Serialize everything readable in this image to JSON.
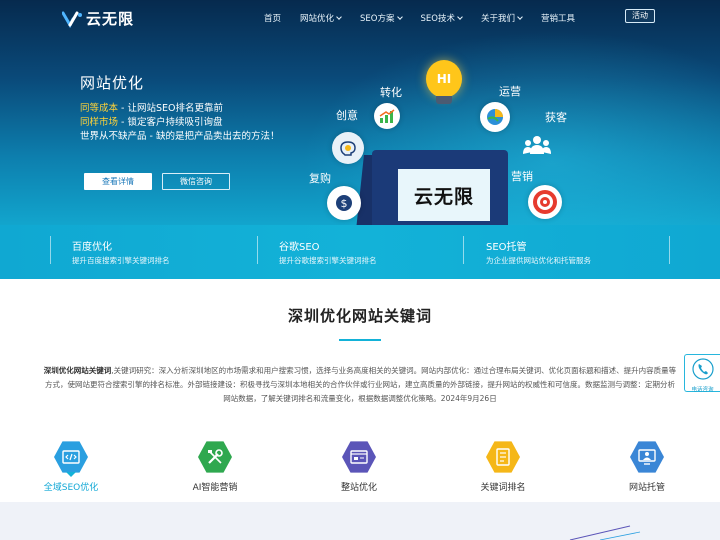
{
  "logo": {
    "text": "云无限"
  },
  "nav": {
    "items": [
      {
        "label": "首页",
        "dropdown": false
      },
      {
        "label": "网站优化",
        "dropdown": true
      },
      {
        "label": "SEO方案",
        "dropdown": true
      },
      {
        "label": "SEO技术",
        "dropdown": true
      },
      {
        "label": "关于我们",
        "dropdown": true
      },
      {
        "label": "营销工具",
        "dropdown": false
      }
    ],
    "action_label": "活动"
  },
  "hero": {
    "title": "网站优化",
    "line1_highlight": "同等成本",
    "line1_rest": " - 让网站SEO排名更靠前",
    "line2_highlight": "同样市场",
    "line2_rest": " - 锁定客户持续吸引询盘",
    "line3": "世界从不缺产品 - 缺的是把产品卖出去的方法！",
    "detail_button": "查看详情",
    "consult_button": "微信咨询",
    "illustration": {
      "words": [
        "创意",
        "转化",
        "运营",
        "获客",
        "复购",
        "营销"
      ],
      "bulb_text": "HI",
      "screen_text": "云无限"
    }
  },
  "services": [
    {
      "title": "百度优化",
      "desc": "提升百度搜索引擎关键词排名"
    },
    {
      "title": "谷歌SEO",
      "desc": "提升谷歌搜索引擎关键词排名"
    },
    {
      "title": "SEO托管",
      "desc": "为企业提供网站优化和托管服务"
    }
  ],
  "section": {
    "title": "深圳优化网站关键词",
    "text_bold": "深圳优化网站关键词",
    "text_body": ",关键词研究：深入分析深圳地区的市场需求和用户搜索习惯，选择与业务高度相关的关键词。网站内部优化：通过合理布局关键词、优化页面标题和描述、提升内容质量等方式，使网站更符合搜索引擎的排名标准。外部链接建设：积极寻找与深圳本地相关的合作伙伴或行业网站，建立高质量的外部链接，提升网站的权威性和可信度。数据监测与调整：定期分析网站数据，了解关键词排名和流量变化，根据数据调整优化策略。2024年9月26日"
  },
  "features": [
    {
      "label": "全域SEO优化",
      "icon": "code-window-icon",
      "color": "#2a9fe0",
      "active": true
    },
    {
      "label": "AI智能营销",
      "icon": "tools-icon",
      "color": "#2fa84f",
      "active": false
    },
    {
      "label": "整站优化",
      "icon": "browser-icon",
      "color": "#5b55b8",
      "active": false
    },
    {
      "label": "关键词排名",
      "icon": "document-icon",
      "color": "#f5b718",
      "active": false
    },
    {
      "label": "网站托管",
      "icon": "monitor-user-icon",
      "color": "#3a86d6",
      "active": false
    }
  ],
  "phone_widget": {
    "label": "电话咨询",
    "icon": "phone-icon"
  }
}
